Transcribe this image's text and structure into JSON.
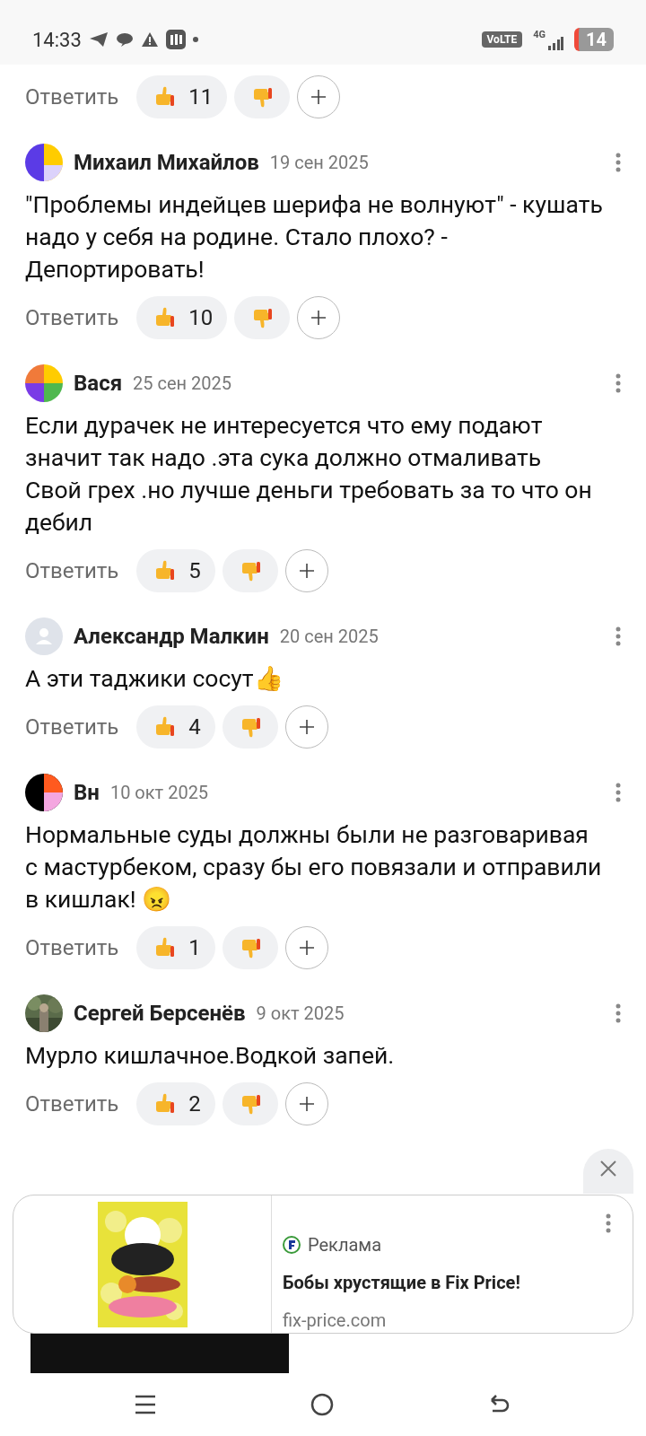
{
  "status_bar": {
    "time": "14:33",
    "network": "VoLTE",
    "signal": "4G",
    "battery": "14"
  },
  "top_actions": {
    "reply": "Ответить",
    "likes": "11"
  },
  "comments": [
    {
      "author": "Михаил Михайлов",
      "date": "19 сен 2025",
      "kind": "blue",
      "text": "\"Проблемы индейцев шерифа не волнуют\" - кушать надо у себя на родине. Стало плохо? - Депортировать!",
      "reply": "Ответить",
      "likes": "10"
    },
    {
      "author": "Вася",
      "date": "25 сен 2025",
      "kind": "quad",
      "text": "Если дурачек не интересуется что ему подают значит так надо .эта сука должно отмаливать Свой грех .но лучше деньги требовать за то что он дебил",
      "reply": "Ответить",
      "likes": "5"
    },
    {
      "author": "Александр Малкин",
      "date": "20 сен 2025",
      "kind": "default",
      "text": "А эти таджики сосут👍",
      "reply": "Ответить",
      "likes": "4"
    },
    {
      "author": "Вн",
      "date": "10 окт 2025",
      "kind": "dark",
      "text": "Нормальные суды должны были не разговаривая с мастурбеком, сразу бы его повязали и отправили в кишлак! 😠",
      "reply": "Ответить",
      "likes": "1"
    },
    {
      "author": "Сергей Берсенёв",
      "date": "9 окт 2025",
      "text": "Мурло кишлачное.Водкой запей.",
      "reply": "Ответить",
      "likes": "2"
    }
  ],
  "ad": {
    "label": "Реклама",
    "title": "Бобы хрустящие в Fix Price!",
    "domain": "fix-price.com"
  }
}
